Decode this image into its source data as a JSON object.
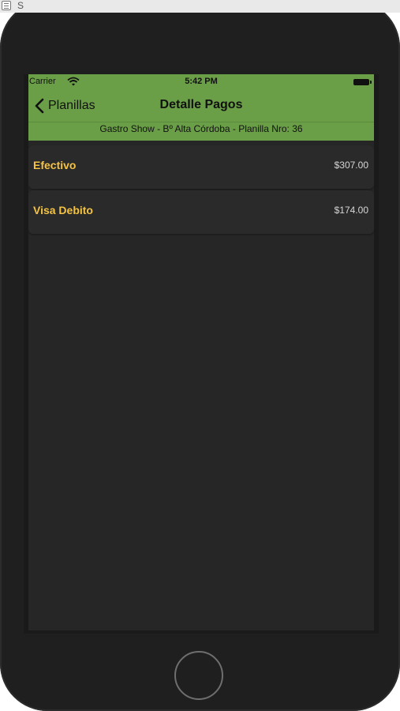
{
  "window": {
    "letter": "S"
  },
  "status_bar": {
    "carrier": "Carrier",
    "time": "5:42 PM"
  },
  "nav": {
    "back_label": "Planillas",
    "title": "Detalle Pagos",
    "subtitle": "Gastro Show - Bº Alta Córdoba - Planilla Nro: 36"
  },
  "payments": [
    {
      "label": "Efectivo",
      "amount": "$307.00"
    },
    {
      "label": "Visa Debito",
      "amount": "$174.00"
    }
  ],
  "colors": {
    "nav_background": "#6a9e47",
    "label_accent": "#f5c343",
    "screen_background": "#262626"
  }
}
